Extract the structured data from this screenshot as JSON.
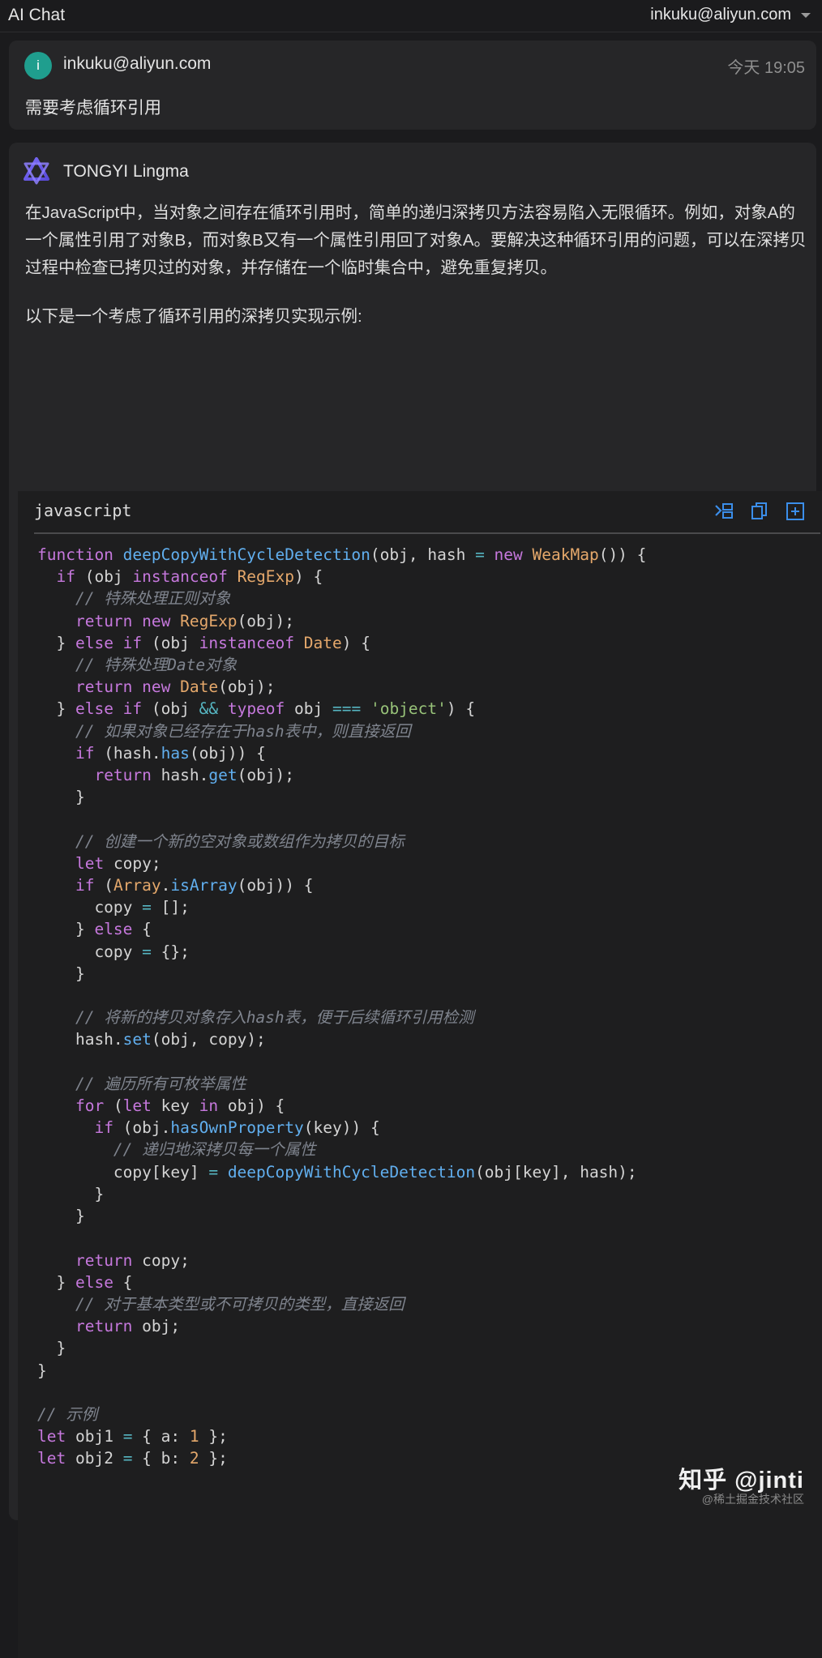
{
  "topbar": {
    "title": "AI Chat",
    "account": "inkuku@aliyun.com"
  },
  "user_message": {
    "avatar_letter": "i",
    "name": "inkuku@aliyun.com",
    "time": "今天 19:05",
    "text": "需要考虑循环引用"
  },
  "assistant": {
    "name": "TONGYI Lingma",
    "paragraph1": "在JavaScript中，当对象之间存在循环引用时，简单的递归深拷贝方法容易陷入无限循环。例如，对象A的一个属性引用了对象B，而对象B又有一个属性引用回了对象A。要解决这种循环引用的问题，可以在深拷贝过程中检查已拷贝过的对象，并存储在一个临时集合中，避免重复拷贝。",
    "paragraph2": "以下是一个考虑了循环引用的深拷贝实现示例:"
  },
  "code_block": {
    "language": "javascript",
    "actions": [
      "insert-icon",
      "copy-icon",
      "new-file-icon"
    ],
    "lines": [
      [
        [
          "kw",
          "function "
        ],
        [
          "fn",
          "deepCopyWithCycleDetection"
        ],
        [
          "",
          "(obj, hash "
        ],
        [
          "op",
          "="
        ],
        [
          "kw",
          " new "
        ],
        [
          "cls",
          "WeakMap"
        ],
        [
          "",
          "()) {"
        ]
      ],
      [
        [
          "",
          "  "
        ],
        [
          "kw",
          "if"
        ],
        [
          "",
          " (obj "
        ],
        [
          "kw",
          "instanceof "
        ],
        [
          "cls",
          "RegExp"
        ],
        [
          "",
          ") {"
        ]
      ],
      [
        [
          "",
          "    "
        ],
        [
          "cm",
          "// 特殊处理正则对象"
        ]
      ],
      [
        [
          "",
          "    "
        ],
        [
          "kw",
          "return new "
        ],
        [
          "cls",
          "RegExp"
        ],
        [
          "",
          "(obj);"
        ]
      ],
      [
        [
          "",
          "  } "
        ],
        [
          "kw",
          "else if"
        ],
        [
          "",
          " (obj "
        ],
        [
          "kw",
          "instanceof "
        ],
        [
          "cls",
          "Date"
        ],
        [
          "",
          ") {"
        ]
      ],
      [
        [
          "",
          "    "
        ],
        [
          "cm",
          "// 特殊处理Date对象"
        ]
      ],
      [
        [
          "",
          "    "
        ],
        [
          "kw",
          "return new "
        ],
        [
          "cls",
          "Date"
        ],
        [
          "",
          "(obj);"
        ]
      ],
      [
        [
          "",
          "  } "
        ],
        [
          "kw",
          "else if"
        ],
        [
          "",
          " (obj "
        ],
        [
          "op",
          "&&"
        ],
        [
          "kw",
          " typeof"
        ],
        [
          "",
          " obj "
        ],
        [
          "op",
          "==="
        ],
        [
          "str",
          " 'object'"
        ],
        [
          "",
          ") {"
        ]
      ],
      [
        [
          "",
          "    "
        ],
        [
          "cm",
          "// 如果对象已经存在于hash表中，则直接返回"
        ]
      ],
      [
        [
          "",
          "    "
        ],
        [
          "kw",
          "if"
        ],
        [
          "",
          " (hash."
        ],
        [
          "fn",
          "has"
        ],
        [
          "",
          "(obj)) {"
        ]
      ],
      [
        [
          "",
          "      "
        ],
        [
          "kw",
          "return"
        ],
        [
          "",
          " hash."
        ],
        [
          "fn",
          "get"
        ],
        [
          "",
          "(obj);"
        ]
      ],
      [
        [
          "",
          "    }"
        ]
      ],
      [
        [
          "",
          ""
        ]
      ],
      [
        [
          "",
          "    "
        ],
        [
          "cm",
          "// 创建一个新的空对象或数组作为拷贝的目标"
        ]
      ],
      [
        [
          "",
          "    "
        ],
        [
          "kw",
          "let"
        ],
        [
          "",
          " copy;"
        ]
      ],
      [
        [
          "",
          "    "
        ],
        [
          "kw",
          "if"
        ],
        [
          "",
          " ("
        ],
        [
          "cls",
          "Array"
        ],
        [
          "",
          "."
        ],
        [
          "fn",
          "isArray"
        ],
        [
          "",
          "(obj)) {"
        ]
      ],
      [
        [
          "",
          "      copy "
        ],
        [
          "op",
          "="
        ],
        [
          "",
          " [];"
        ]
      ],
      [
        [
          "",
          "    } "
        ],
        [
          "kw",
          "else"
        ],
        [
          "",
          " {"
        ]
      ],
      [
        [
          "",
          "      copy "
        ],
        [
          "op",
          "="
        ],
        [
          "",
          " {};"
        ]
      ],
      [
        [
          "",
          "    }"
        ]
      ],
      [
        [
          "",
          ""
        ]
      ],
      [
        [
          "",
          "    "
        ],
        [
          "cm",
          "// 将新的拷贝对象存入hash表，便于后续循环引用检测"
        ]
      ],
      [
        [
          "",
          "    hash."
        ],
        [
          "fn",
          "set"
        ],
        [
          "",
          "(obj, copy);"
        ]
      ],
      [
        [
          "",
          ""
        ]
      ],
      [
        [
          "",
          "    "
        ],
        [
          "cm",
          "// 遍历所有可枚举属性"
        ]
      ],
      [
        [
          "",
          "    "
        ],
        [
          "kw",
          "for"
        ],
        [
          "",
          " ("
        ],
        [
          "kw",
          "let"
        ],
        [
          "",
          " key "
        ],
        [
          "kw",
          "in"
        ],
        [
          "",
          " obj) {"
        ]
      ],
      [
        [
          "",
          "      "
        ],
        [
          "kw",
          "if"
        ],
        [
          "",
          " (obj."
        ],
        [
          "fn",
          "hasOwnProperty"
        ],
        [
          "",
          "(key)) {"
        ]
      ],
      [
        [
          "",
          "        "
        ],
        [
          "cm",
          "// 递归地深拷贝每一个属性"
        ]
      ],
      [
        [
          "",
          "        copy[key] "
        ],
        [
          "op",
          "="
        ],
        [
          "fn",
          " deepCopyWithCycleDetection"
        ],
        [
          "",
          "(obj[key], hash);"
        ]
      ],
      [
        [
          "",
          "      }"
        ]
      ],
      [
        [
          "",
          "    }"
        ]
      ],
      [
        [
          "",
          ""
        ]
      ],
      [
        [
          "",
          "    "
        ],
        [
          "kw",
          "return"
        ],
        [
          "",
          " copy;"
        ]
      ],
      [
        [
          "",
          "  } "
        ],
        [
          "kw",
          "else"
        ],
        [
          "",
          " {"
        ]
      ],
      [
        [
          "",
          "    "
        ],
        [
          "cm",
          "// 对于基本类型或不可拷贝的类型，直接返回"
        ]
      ],
      [
        [
          "",
          "    "
        ],
        [
          "kw",
          "return"
        ],
        [
          "",
          " obj;"
        ]
      ],
      [
        [
          "",
          "  }"
        ]
      ],
      [
        [
          "",
          "}"
        ]
      ],
      [
        [
          "",
          ""
        ]
      ],
      [
        [
          "cm",
          "// 示例"
        ]
      ],
      [
        [
          "kw",
          "let"
        ],
        [
          "",
          " obj1 "
        ],
        [
          "op",
          "="
        ],
        [
          "",
          " { a: "
        ],
        [
          "cls",
          "1"
        ],
        [
          "",
          " };"
        ]
      ],
      [
        [
          "kw",
          "let"
        ],
        [
          "",
          " obj2 "
        ],
        [
          "op",
          "="
        ],
        [
          "",
          " { b: "
        ],
        [
          "cls",
          "2"
        ],
        [
          "",
          " };"
        ]
      ]
    ]
  },
  "watermark": {
    "main": "知乎 @jinti",
    "sub": "@稀土掘金技术社区"
  },
  "colors": {
    "keyword": "#c678dd",
    "function": "#61afef",
    "class": "#e5a86b",
    "string": "#98c379",
    "comment": "#7f848e",
    "operator": "#56b6c2",
    "accent_blue": "#3b8eea",
    "avatar": "#1f9e8e"
  }
}
